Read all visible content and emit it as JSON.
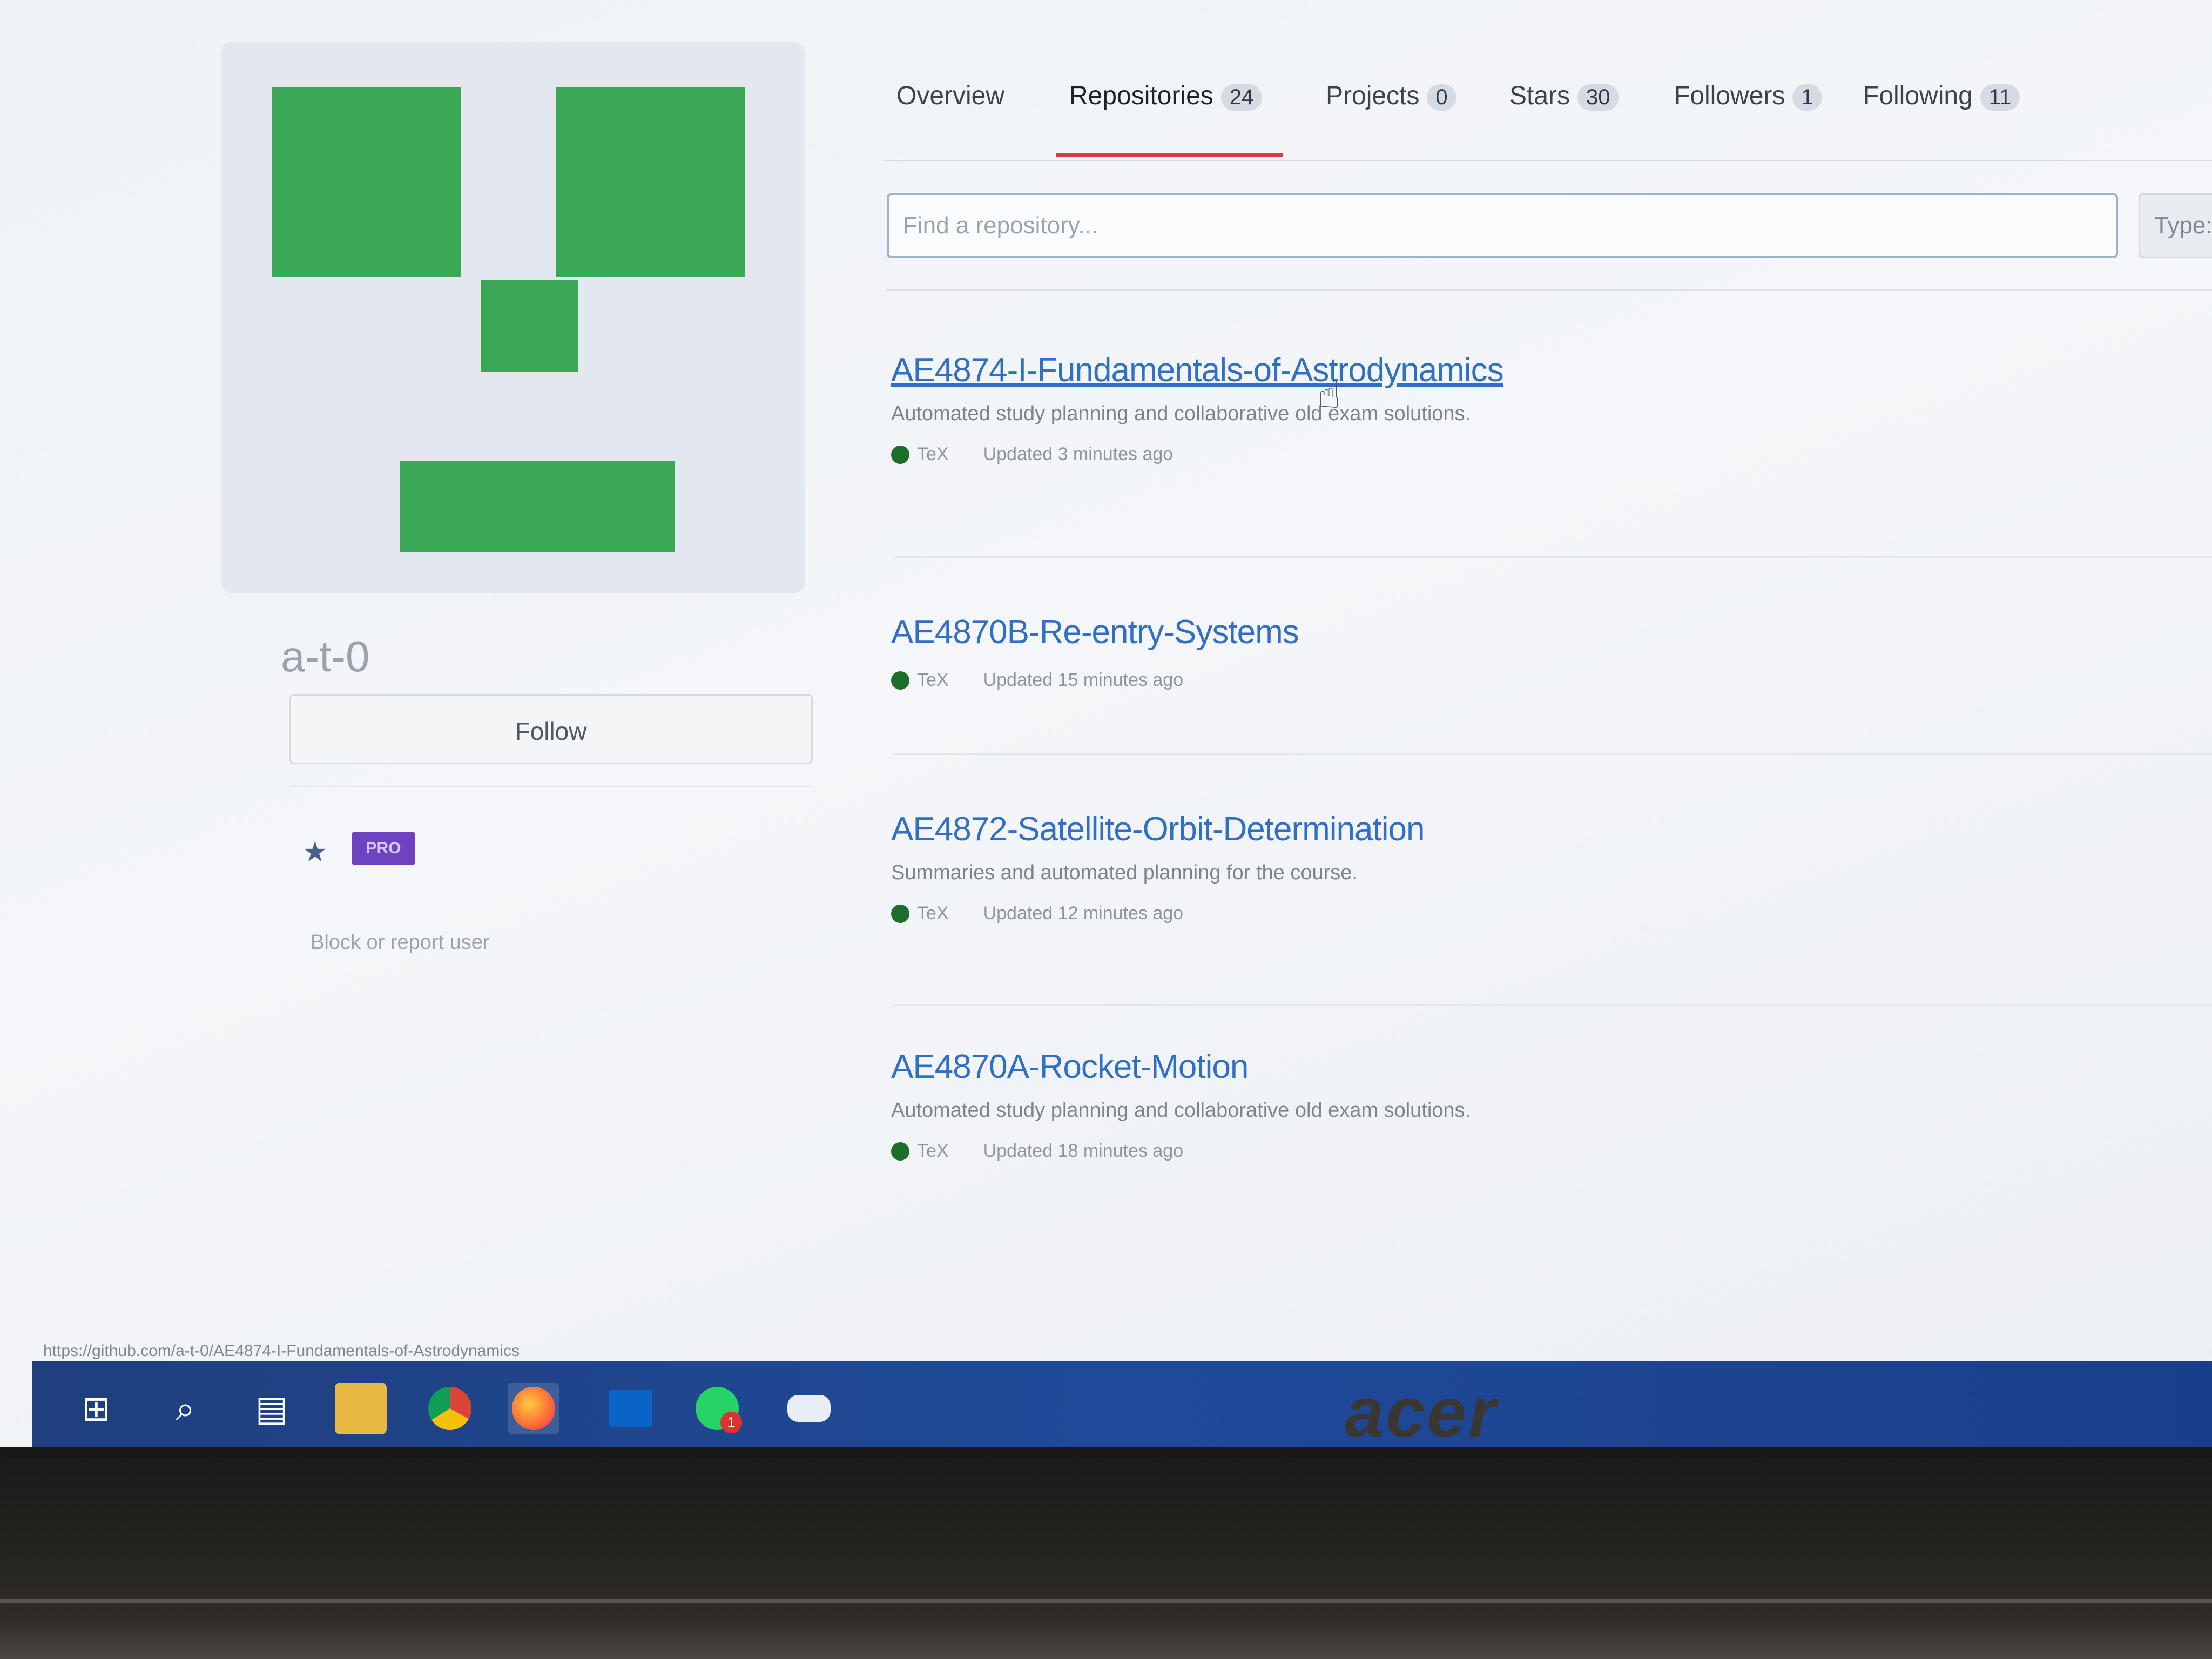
{
  "brand": {
    "logo_text": "acer"
  },
  "profile": {
    "username": "a-t-0",
    "follow_label": "Follow",
    "pro_label": "PRO",
    "block_label": "Block or report user"
  },
  "tabs": [
    {
      "label": "Overview",
      "count": ""
    },
    {
      "label": "Repositories",
      "count": "24"
    },
    {
      "label": "Projects",
      "count": "0"
    },
    {
      "label": "Stars",
      "count": "30"
    },
    {
      "label": "Followers",
      "count": "1"
    },
    {
      "label": "Following",
      "count": "11"
    }
  ],
  "search": {
    "placeholder": "Find a repository...",
    "type_label": "Type:"
  },
  "repos": [
    {
      "name": "AE4874-I-Fundamentals-of-Astrodynamics",
      "description": "Automated study planning and collaborative old exam solutions.",
      "language": "TeX",
      "updated": "Updated 3 minutes ago"
    },
    {
      "name": "AE4870B-Re-entry-Systems",
      "description": "",
      "language": "TeX",
      "updated": "Updated 15 minutes ago"
    },
    {
      "name": "AE4872-Satellite-Orbit-Determination",
      "description": "Summaries and automated planning for the course.",
      "language": "TeX",
      "updated": "Updated 12 minutes ago"
    },
    {
      "name": "AE4870A-Rocket-Motion",
      "description": "Automated study planning and collaborative old exam solutions.",
      "language": "TeX",
      "updated": "Updated 18 minutes ago"
    }
  ],
  "status_url": "https://github.com/a-t-0/AE4874-I-Fundamentals-of-Astrodynamics",
  "taskbar": {
    "icons": [
      "windows-start-icon",
      "search-icon",
      "task-view-icon",
      "file-explorer-icon",
      "chrome-icon",
      "firefox-icon",
      "outlook-icon",
      "whatsapp-icon",
      "snipping-tool-icon"
    ],
    "notification_badge": "1"
  },
  "colors": {
    "accent_link": "#2f6fc6",
    "tab_underline": "#d73a49",
    "avatar_green": "#3aa755",
    "pro_badge": "#6f42c1",
    "taskbar": "#1f4a9a"
  }
}
